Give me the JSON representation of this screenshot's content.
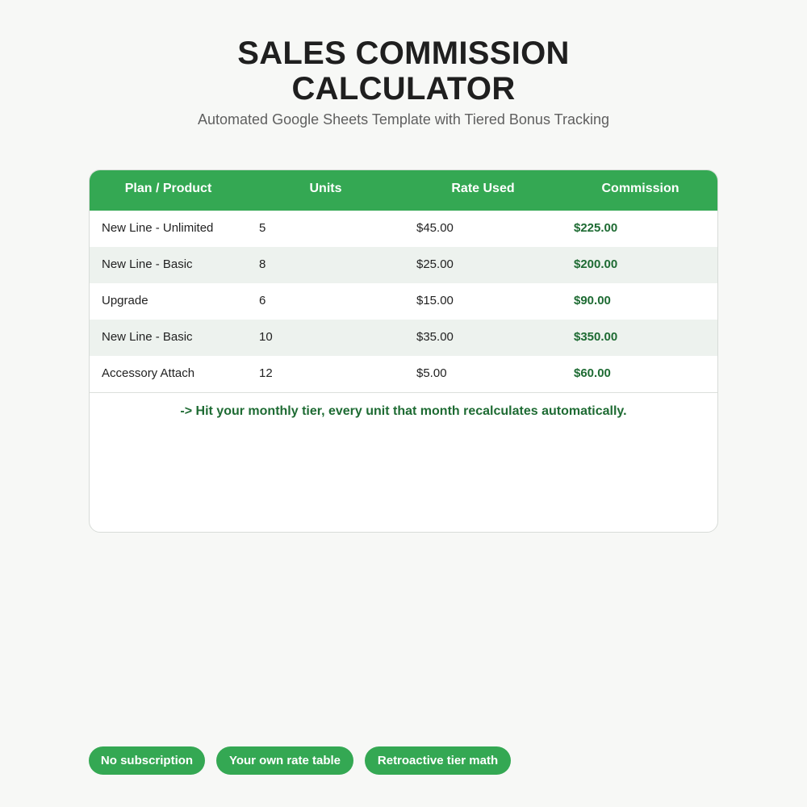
{
  "header": {
    "title_line1": "SALES COMMISSION",
    "title_line2": "CALCULATOR",
    "subtitle": "Automated Google Sheets Template with Tiered Bonus Tracking"
  },
  "table": {
    "columns": [
      "Plan / Product",
      "Units",
      "Rate Used",
      "Commission"
    ],
    "rows": [
      {
        "plan": "New Line - Unlimited",
        "units": "5",
        "rate": "$45.00",
        "commission": "$225.00"
      },
      {
        "plan": "New Line - Basic",
        "units": "8",
        "rate": "$25.00",
        "commission": "$200.00"
      },
      {
        "plan": "Upgrade",
        "units": "6",
        "rate": "$15.00",
        "commission": "$90.00"
      },
      {
        "plan": "New Line - Basic",
        "units": "10",
        "rate": "$35.00",
        "commission": "$350.00"
      },
      {
        "plan": "Accessory Attach",
        "units": "12",
        "rate": "$5.00",
        "commission": "$60.00"
      }
    ],
    "note": "-> Hit your monthly tier, every unit that month recalculates automatically."
  },
  "features": [
    "No subscription",
    "Your own rate table",
    "Retroactive tier math"
  ],
  "colors": {
    "accent": "#34a853",
    "commission_text": "#1e6b33",
    "background": "#f7f8f6",
    "row_alt": "#edf2ee"
  }
}
